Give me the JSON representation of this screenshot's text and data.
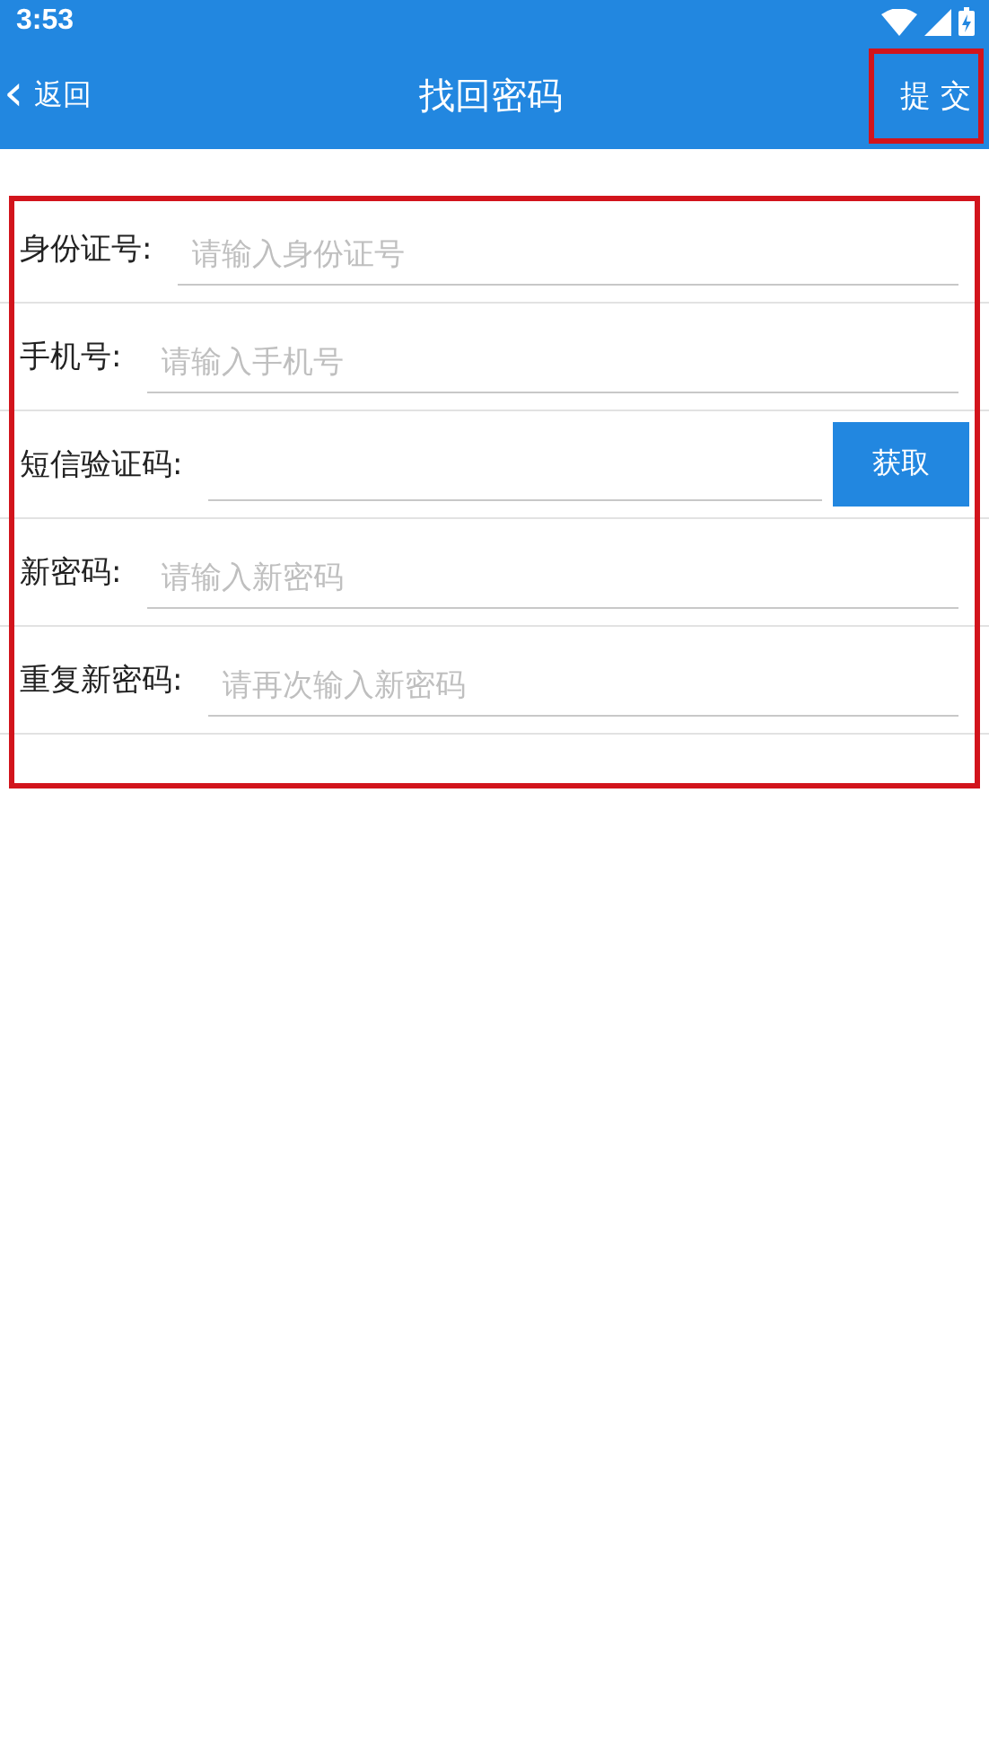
{
  "status_bar": {
    "time": "3:53"
  },
  "app_bar": {
    "back": {
      "icon": "‹",
      "label": "返回"
    },
    "title": "找回密码",
    "submit": {
      "label": "提 交",
      "highlighted": true
    }
  },
  "form": {
    "highlighted": true,
    "rows": [
      {
        "kind": "text",
        "label": "身份证号:",
        "placeholder": "请输入身份证号"
      },
      {
        "kind": "text",
        "label": "手机号:",
        "placeholder": "请输入手机号"
      },
      {
        "kind": "code",
        "label": "短信验证码:",
        "button": "获取"
      },
      {
        "kind": "text",
        "label": "新密码:",
        "placeholder": "请输入新密码"
      },
      {
        "kind": "text",
        "label": "重复新密码:",
        "placeholder": "请再次输入新密码"
      }
    ]
  }
}
